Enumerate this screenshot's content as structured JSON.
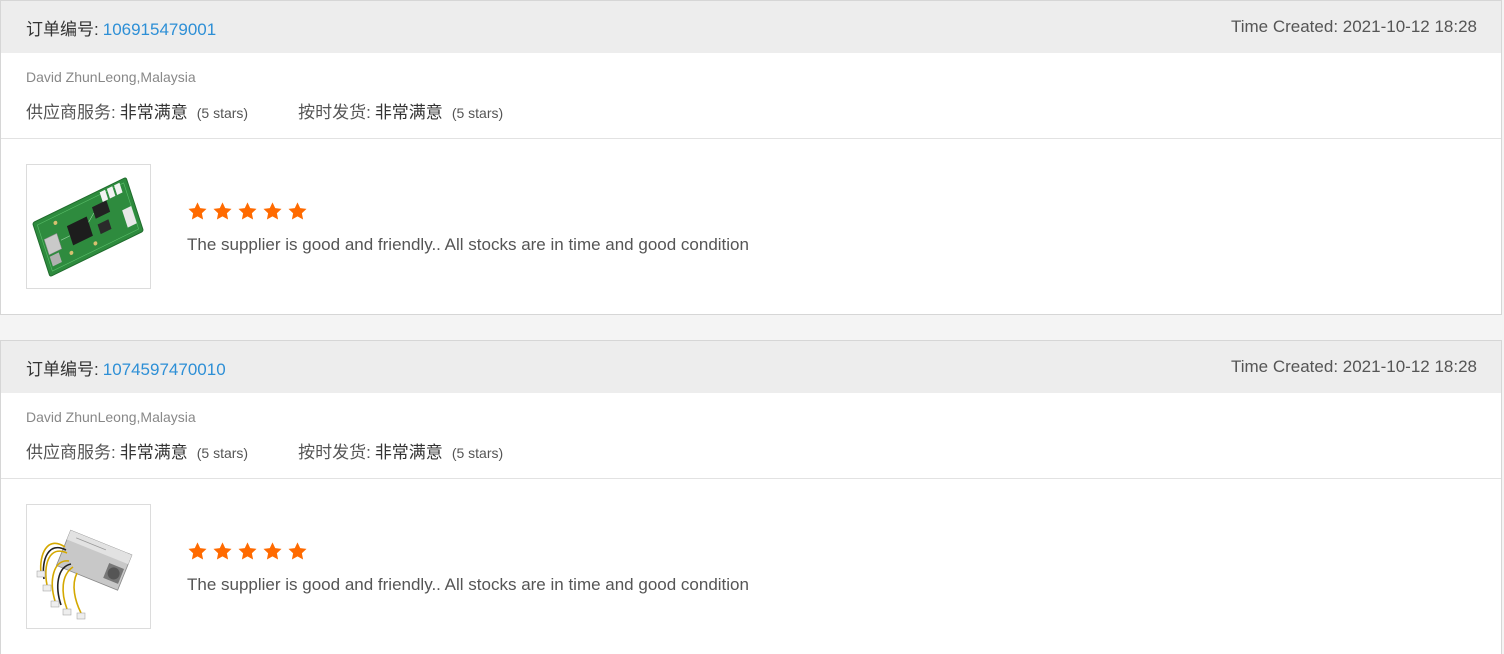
{
  "reviews": [
    {
      "order_label": "订单编号:",
      "order_number": "106915479001",
      "time_created": "Time Created: 2021-10-12 18:28",
      "buyer": "David ZhunLeong,Malaysia",
      "supplier_service": {
        "label": "供应商服务:",
        "value": "非常满意",
        "stars": "(5 stars)"
      },
      "on_time_delivery": {
        "label": "按时发货:",
        "value": "非常满意",
        "stars": "(5 stars)"
      },
      "product_image": "circuit-board-image",
      "rating": 5,
      "text": "The supplier is good and friendly.. All stocks are in time and good condition"
    },
    {
      "order_label": "订单编号:",
      "order_number": "1074597470010",
      "time_created": "Time Created: 2021-10-12 18:28",
      "buyer": "David ZhunLeong,Malaysia",
      "supplier_service": {
        "label": "供应商服务:",
        "value": "非常满意",
        "stars": "(5 stars)"
      },
      "on_time_delivery": {
        "label": "按时发货:",
        "value": "非常满意",
        "stars": "(5 stars)"
      },
      "product_image": "power-supply-image",
      "rating": 5,
      "text": "The supplier is good and friendly.. All stocks are in time and good condition"
    }
  ],
  "colors": {
    "accent_link": "#2d8fd6",
    "star": "#ff6a00",
    "header_bg": "#ededed"
  }
}
